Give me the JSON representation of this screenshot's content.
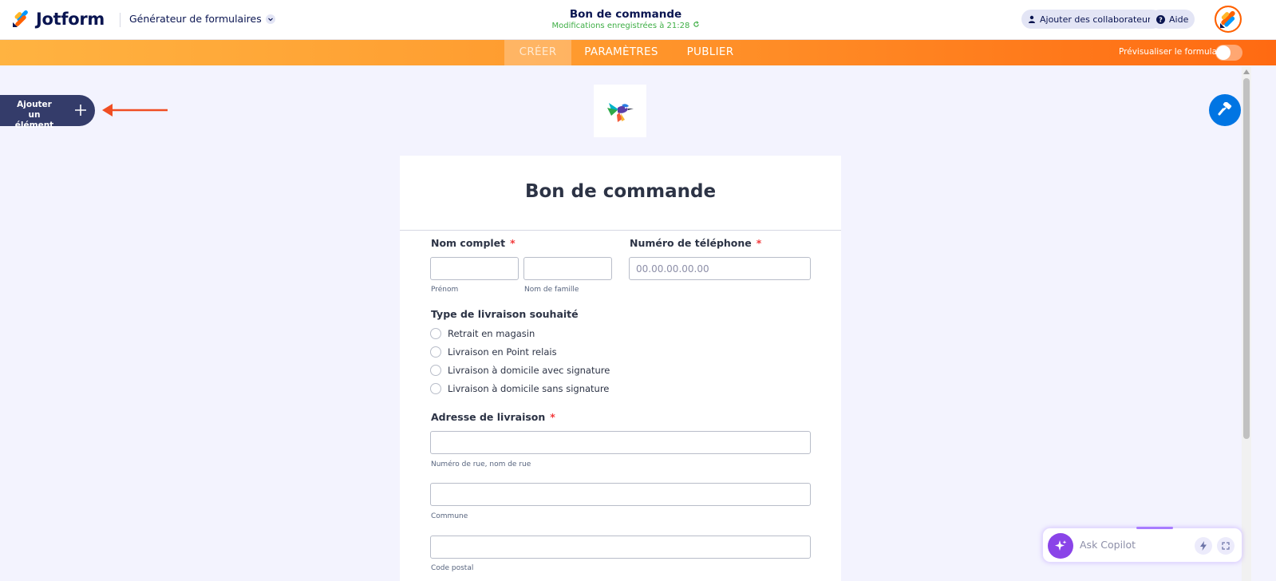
{
  "header": {
    "brand": "Jotform",
    "builder_menu": "Générateur de formulaires",
    "form_title": "Bon de commande",
    "save_status": "Modifications enregistrées à 21:28",
    "collaborators_label": "Ajouter des collaborateurs",
    "help_label": "Aide"
  },
  "nav": {
    "tabs": [
      {
        "label": "CRÉER",
        "active": true
      },
      {
        "label": "PARAMÈTRES",
        "active": false
      },
      {
        "label": "PUBLIER",
        "active": false
      }
    ],
    "preview_label": "Prévisualiser le formulaire",
    "preview_enabled": false
  },
  "sidebar": {
    "add_element_label": "Ajouter un élément"
  },
  "form": {
    "title": "Bon de commande",
    "full_name": {
      "label": "Nom complet",
      "required": "*",
      "first_value": "",
      "last_value": "",
      "first_sublabel": "Prénom",
      "last_sublabel": "Nom de famille"
    },
    "phone": {
      "label": "Numéro de téléphone",
      "required": "*",
      "placeholder": "00.00.00.00.00",
      "value": ""
    },
    "delivery_type": {
      "label": "Type de livraison souhaité",
      "options": [
        "Retrait en magasin",
        "Livraison en Point relais",
        "Livraison à domicile avec signature",
        "Livraison à domicile sans signature"
      ]
    },
    "address": {
      "label": "Adresse de livraison",
      "required": "*",
      "street_sublabel": "Numéro de rue, nom de rue",
      "city_sublabel": "Commune",
      "postal_sublabel": "Code postal"
    }
  },
  "copilot": {
    "placeholder": "Ask Copilot"
  },
  "colors": {
    "brand_navy": "#0a1551",
    "nav_orange_start": "#ffb341",
    "nav_orange_end": "#ff6a12",
    "required_red": "#f23a3c",
    "save_green": "#3eae45",
    "paint_blue": "#0075e3",
    "copilot_purple": "#8a44e8"
  }
}
